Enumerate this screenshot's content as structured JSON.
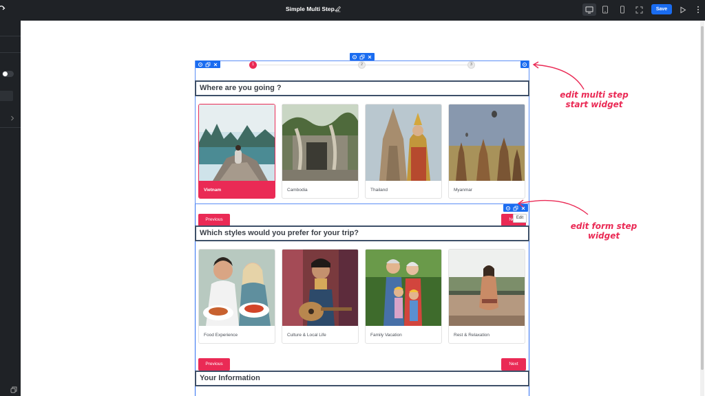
{
  "app": {
    "title": "Simple Multi Step...",
    "save_label": "Save",
    "colors": {
      "accent": "#ea2a55",
      "primary": "#1a6cf0",
      "topbar": "#1f2226"
    },
    "toolbar_icons": [
      "desktop-icon",
      "tablet-icon",
      "mobile-icon",
      "fullscreen-icon",
      "play-icon",
      "more-vertical-icon"
    ]
  },
  "steps": {
    "items": [
      "1",
      "2",
      "3"
    ],
    "active": "1"
  },
  "step1": {
    "question": "Where are you going ?",
    "options": [
      {
        "label": "Vietnam",
        "selected": true
      },
      {
        "label": "Cambodia",
        "selected": false
      },
      {
        "label": "Thailand",
        "selected": false
      },
      {
        "label": "Myanmar",
        "selected": false
      }
    ],
    "prev_label": "Previous",
    "next_label": "Next"
  },
  "step2": {
    "question": "Which styles would you prefer for your trip?",
    "options": [
      {
        "label": "Food Experience"
      },
      {
        "label": "Culture & Local Life"
      },
      {
        "label": "Family Vacation"
      },
      {
        "label": "Rest & Relaxation"
      }
    ],
    "prev_label": "Previous",
    "next_label": "Next"
  },
  "step3": {
    "question": "Your Information"
  },
  "tooltip": "Edit",
  "annotations": {
    "a1": "edit multi step start widget",
    "a1_line1": "edit multi step",
    "a1_line2": "start widget",
    "a2_line1": "edit form step",
    "a2_line2": "widget"
  }
}
